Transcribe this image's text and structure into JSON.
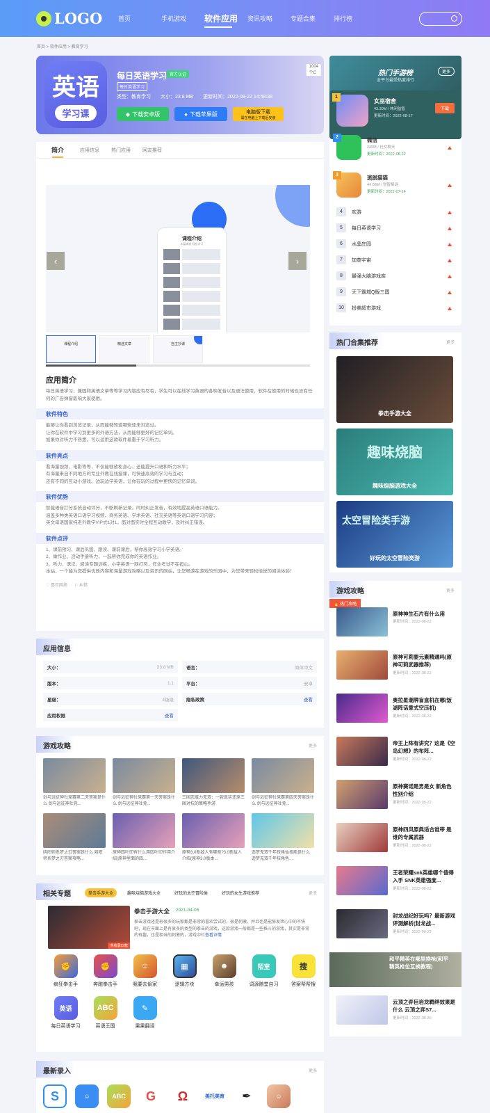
{
  "header": {
    "logo": "LOGO",
    "nav": [
      "首页",
      "手机游戏",
      "软件应用",
      "资讯攻略",
      "专题合集",
      "排行榜"
    ],
    "active_nav": 2
  },
  "breadcrumb": "首页 > 软件应用 > 教育学习",
  "app": {
    "icon_text1": "英语",
    "icon_text2": "学习课",
    "name": "每日英语学习",
    "verified": "官方认证",
    "highlight": "1004个C",
    "tag": "每日英语学习",
    "type": "类型：教育学习",
    "size": "大小：23.8 MB",
    "updated": "更新时间：2022-08-22 14:48:38",
    "btn_android": "下载安卓版",
    "btn_ios": "下载苹果版",
    "btn_pc": "电脑版下载",
    "btn_pc_sub": "需在电脑上下载后安装"
  },
  "tabs": [
    "简介",
    "应用信息",
    "热门应用",
    "网友推荐"
  ],
  "gallery": {
    "phone_title": "课程介绍",
    "phone_sub": "丰富课程 轻松学习",
    "thumbs": [
      "课程介绍",
      "精选文章",
      "自主抄课"
    ]
  },
  "intro": {
    "title": "应用简介",
    "text": "每日英语学习，兼固和英语文章等等学习内容应有尽有，学生可以在线学习英语的各种发音以及语法使用，软件在使用的时候也没有任何的广告弹窗影响大家使用。",
    "sections": [
      {
        "title": "软件特色",
        "lines": [
          "能够让你看到浏览记录，从而能够知道哪些还未浏览过。",
          "让你在软件中学习到更多的外语方法，从而能够更好的记忆单词。",
          "如果你对听力不熟悉，可以运用这款软件着重于学习听力。"
        ]
      },
      {
        "title": "软件亮点",
        "lines": [
          "看海量视频、电影等等，不仅能够放松身心，还能提升口语和听力水平；",
          "有海量来自不同地方的专业外教在线授课，可快速高效的学习与互动；",
          "还有不同的互动小游戏、边玩边学英语，让你在玩的过程中更快的记忆单词。"
        ]
      },
      {
        "title": "软件优势",
        "lines": [
          "智能语音打分系统自动评分，不断刷新记录，同时纠正发音，有效地提高英语口语能力。",
          "涵盖多种类英语口语学习视频，商务英语、学术英语、社交英语等英语口语学习内容；",
          "英文母语国家纯老外教学VIP式1对1，面对面实时全程互动教学，及时纠正错误。"
        ]
      },
      {
        "title": "软件点评",
        "lines": [
          "1、课前预习、课后巩固、跟读、课前课后，帮你高效学习小学英语。",
          "2、做作业、活动手册听力，一起帮你完成你的英语作业。",
          "3、听力、语法、阅读专题训练，小学英语一网打尽，作业考试不在担心。",
          "本站，一个能为您提供优质内容和海量游戏攻略以及资讯的网站，让您畅游在游戏的乐园中，为您带来轻松愉悦的阅读体验！"
        ]
      }
    ],
    "like": "喜欢网络",
    "report": "纠错"
  },
  "info": {
    "title": "应用信息",
    "cells": [
      {
        "k": "大小：",
        "v": "23.8 MB"
      },
      {
        "k": "语言：",
        "v": "简体中文"
      },
      {
        "k": "版本：",
        "v": "1.1"
      },
      {
        "k": "平台：",
        "v": "安卓"
      },
      {
        "k": "星级：",
        "v": "4级级"
      },
      {
        "k": "隐私政策",
        "v": "查看"
      },
      {
        "k": "应用权限",
        "v": "查看"
      }
    ]
  },
  "strategy": {
    "title": "游戏攻略",
    "more": "更多",
    "items": [
      "剑与远征神社竞赛第二天答案是什么 剑与远征神社竞...",
      "剑与远征神社竞赛第一天答案是什么 剑与远征神社竞...",
      "三国志威力无双：一款真实还原三国对抗的策略手游",
      "剑与远征神社竞赛第四天答案是什么 剑与远征神社竞...",
      "阴阳师系梦之刃答案是什么 阴阳师系梦之刃答案攻略...",
      "原神四叶印有什么用四叶印作用介绍(原神里面的四...",
      "原神3.0新敌人有哪些?3.0新敌人介绍(原神3.0版本...",
      "造梦无双千年技角仙技能是什么 造梦无双千年技角色..."
    ]
  },
  "topic": {
    "title": "相关专题",
    "more": "更多",
    "tabs": [
      "拳击手游大全",
      "趣味烧脑游戏大全",
      "好玩的太空冒险类",
      "好玩的女生游戏推荐"
    ],
    "badge": "共收录12款",
    "name": "拳击手游大全",
    "date": "2021-04-05",
    "desc": "拳击游戏还是有很多的玩家都是非常的喜欢尝试的，很是刺激，并且也是能够发泄心中的不快吧，现在市面上是有很多的类型的拳击的游戏，这款游戏一般都是一些格斗的游戏，其实是非常的有趣，也是相当的刺激的，游戏中社",
    "read_more": "查看详情",
    "apps": [
      "疯狂拳击手",
      "奔跑拳击手",
      "我要去偷家",
      "逻辑方块",
      "幸运男孩",
      "词源随堂自习",
      "答案帮帮搜",
      "每日英语学习",
      "英语王国",
      "果果翻译"
    ]
  },
  "latest": {
    "title": "最新录入",
    "more": "更多"
  },
  "rank": {
    "title": "热门手游榜",
    "subtitle": "全平台最受热度排行",
    "more": "更多",
    "top": [
      {
        "n": "1",
        "name": "女巫宿舍",
        "size": "43.30M / 休闲益智",
        "date": "更新时间：2022-08-17",
        "dl": "下载"
      },
      {
        "n": "2",
        "name": "微信",
        "size": "245M / 社交聊天",
        "date": "更新时间：2022-08-22"
      },
      {
        "n": "3",
        "name": "逃脱猫猫",
        "size": "44.08M / 冒智解谜",
        "date": "更新时间：2022-07-14"
      }
    ],
    "list": [
      {
        "n": "4",
        "name": "欢游"
      },
      {
        "n": "5",
        "name": "每日英语学习"
      },
      {
        "n": "6",
        "name": "水晶庄园"
      },
      {
        "n": "7",
        "name": "加查宇宙"
      },
      {
        "n": "8",
        "name": "最强大脑游戏库"
      },
      {
        "n": "9",
        "name": "天下霸城Q版三国"
      },
      {
        "n": "10",
        "name": "扮美超市游戏"
      }
    ]
  },
  "collections": {
    "title": "热门合集推荐",
    "more": "更多",
    "items": [
      {
        "big": "",
        "name": "拳击手游大全"
      },
      {
        "big": "趣味烧脑",
        "name": "趣味烧脑游戏大全"
      },
      {
        "big": "太空冒险类手游",
        "name": "好玩的太空冒险类游"
      }
    ]
  },
  "guides": {
    "title": "游戏攻略",
    "more": "更多",
    "hot": "热门攻略",
    "items": [
      {
        "title": "原神神生石片有什么用",
        "date": "更新时间：2022-08-22"
      },
      {
        "title": "原神可莉要元素精通吗(原神可莉武器推荐)",
        "date": "更新时间：2022-08-22"
      },
      {
        "title": "奥拉星潮牌盲盒机在哪(饭湖阵话意式空压机)",
        "date": "更新时间：2022-08-22"
      },
      {
        "title": "帝王上阵有讲究？这是《空岛幻想》的布阵...",
        "date": "更新时间：2022-08-22"
      },
      {
        "title": "原神赛诺是男是女 新角色性别介绍",
        "date": "更新时间：2022-08-22"
      },
      {
        "title": "原神四风原典适合谁带 是谁的专属武器",
        "date": "更新时间：2022-08-22"
      },
      {
        "title": "王者荣耀snk英雄哪个值得入手 SNK英雄强度...",
        "date": "更新时间：2022-08-22"
      },
      {
        "title": "封龙战纪好玩吗？最新游戏评测解析(封龙战...",
        "date": "更新时间：2022-08-22"
      },
      {
        "title": "和平精英在哪里换枪(和平精英枪位互换教程)",
        "date": "更新时间：2022-08-22"
      },
      {
        "title": "云顶之弈巨岩龙羁绊效果是什么 云顶之弈S7...",
        "date": "更新时间：2022-08-26"
      }
    ]
  },
  "colors": {
    "accent": "#3a63c9",
    "brand_gradient_start": "#5a9cf7",
    "download_orange": "#f36d3e"
  }
}
